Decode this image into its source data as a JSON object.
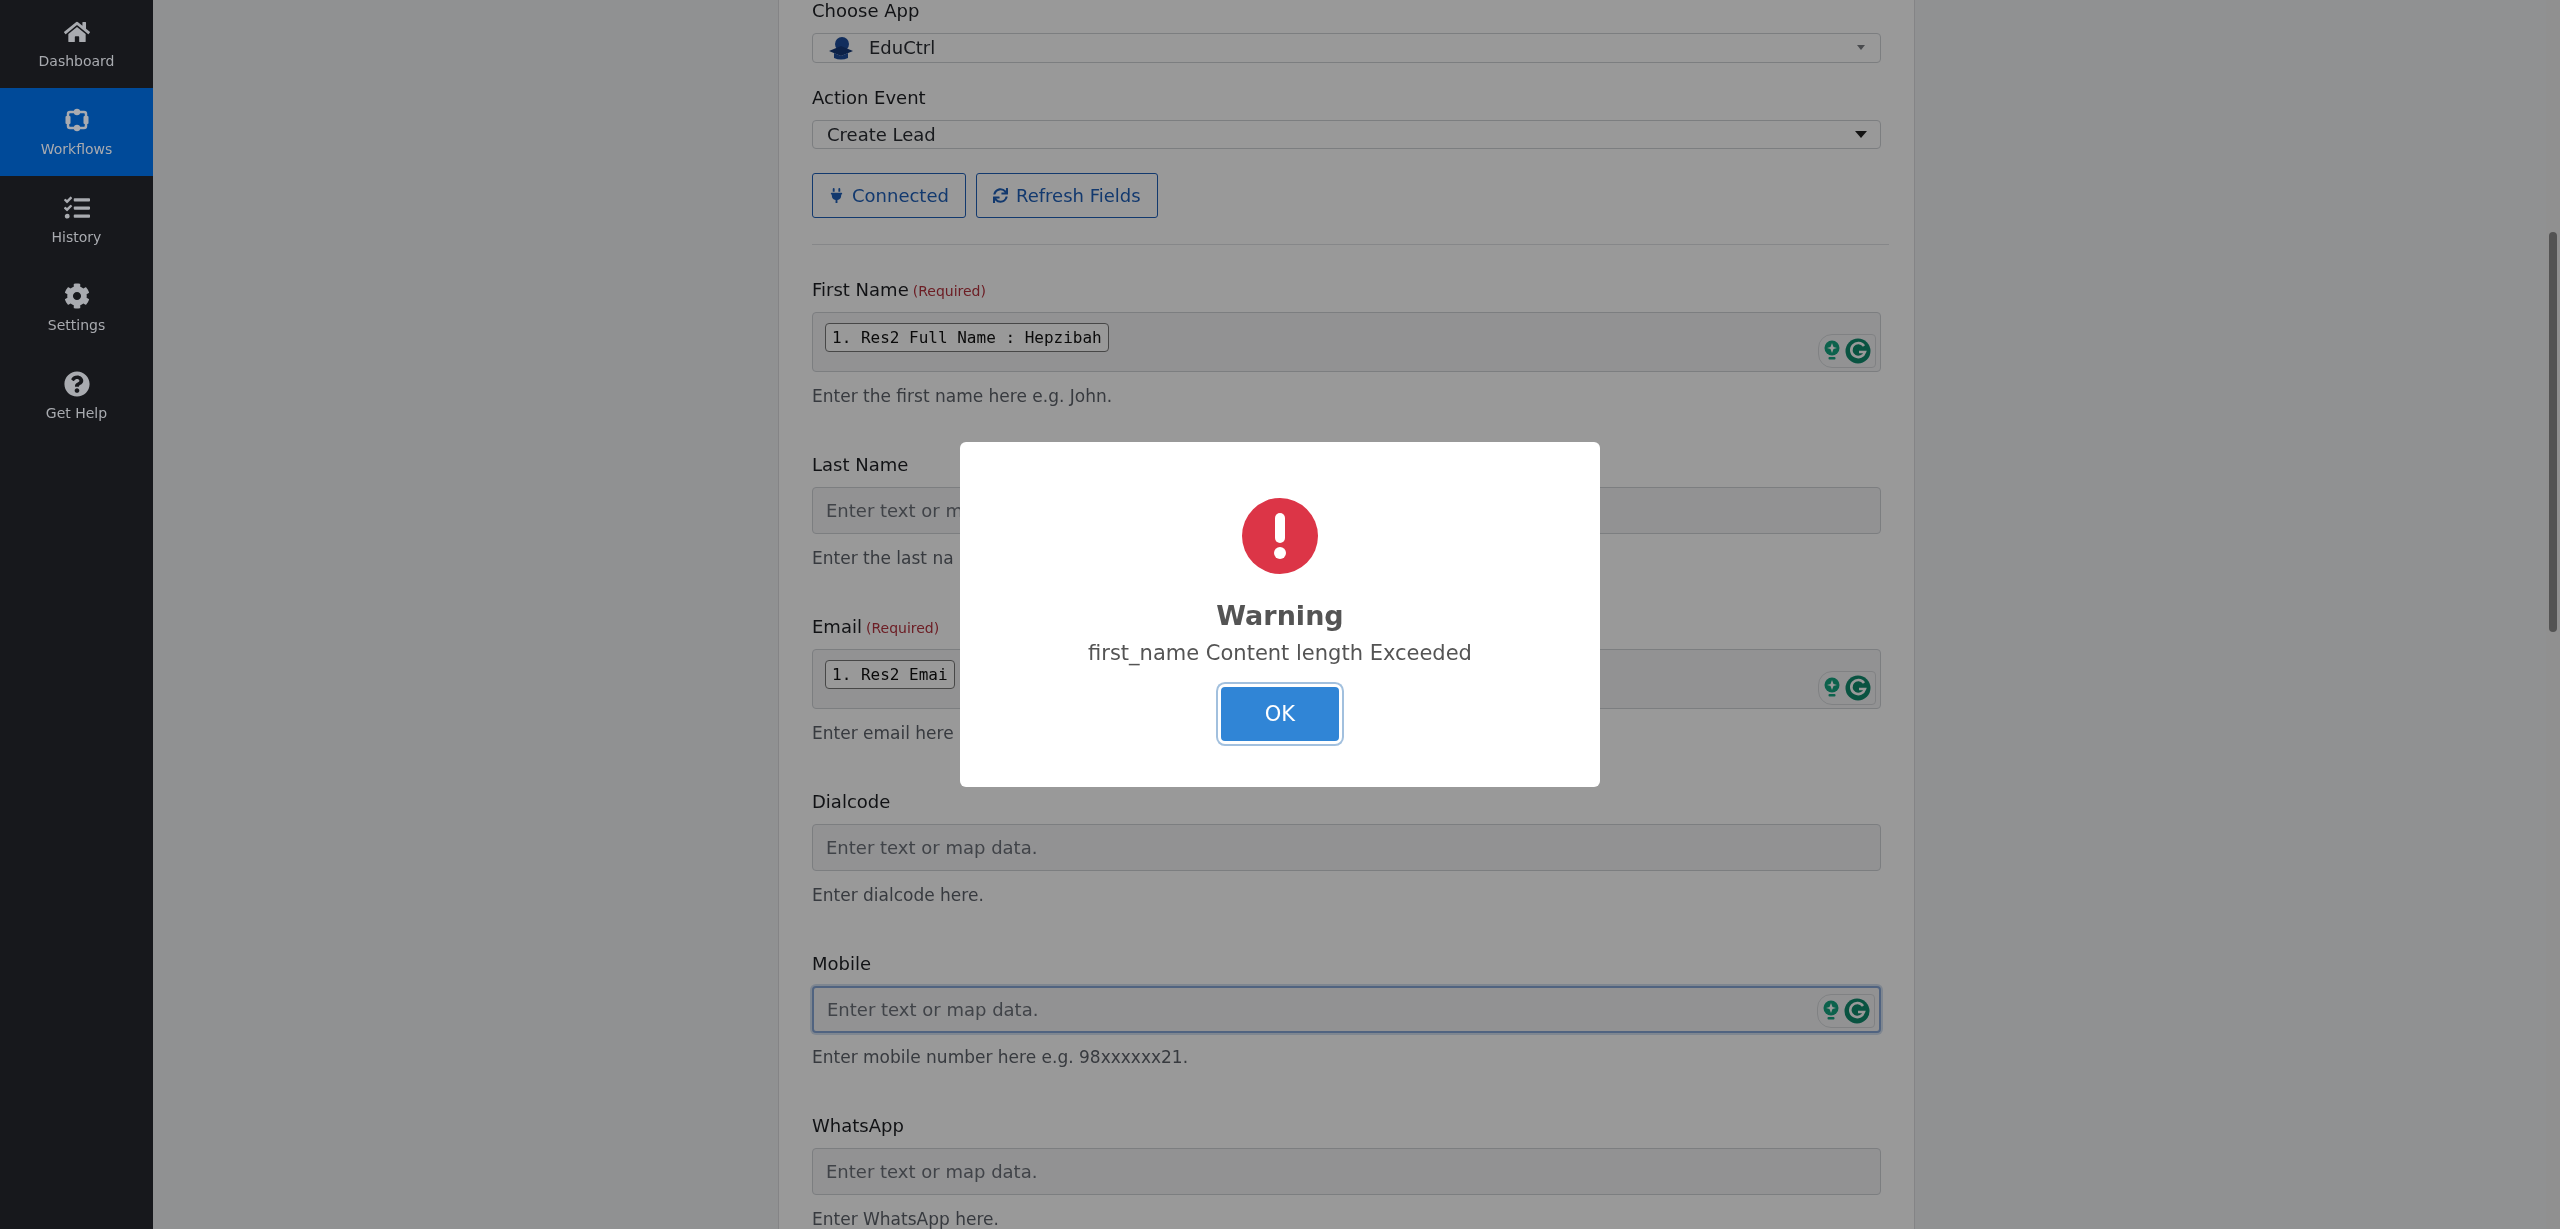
{
  "sidebar": {
    "items": [
      {
        "label": "Dashboard",
        "selected": false
      },
      {
        "label": "Workflows",
        "selected": true
      },
      {
        "label": "History",
        "selected": false
      },
      {
        "label": "Settings",
        "selected": false
      },
      {
        "label": "Get Help",
        "selected": false
      }
    ]
  },
  "form": {
    "app_select": {
      "label": "Choose App",
      "value": "EduCtrl"
    },
    "event_select": {
      "label": "Action Event",
      "value": "Create Lead"
    },
    "buttons": [
      {
        "label": "Connected"
      },
      {
        "label": "Refresh Fields"
      }
    ],
    "fields": [
      {
        "label": "First Name",
        "required_note": "(Required)",
        "chip": "1. Res2 Full Name : Hepzibah",
        "assist_icons": true,
        "focused": false,
        "hint": "Enter the first name here e.g. John."
      },
      {
        "label": "Last Name",
        "placeholder": "Enter text or m",
        "assist_icons": false,
        "focused": false,
        "hint": "Enter the last na"
      },
      {
        "label": "Email",
        "required_note": "(Required)",
        "chip": "1. Res2 Emai",
        "assist_icons": true,
        "focused": false,
        "hint": "Enter email here"
      },
      {
        "label": "Dialcode",
        "placeholder": "Enter text or map data.",
        "assist_icons": false,
        "focused": false,
        "hint": "Enter dialcode here."
      },
      {
        "label": "Mobile",
        "placeholder": "Enter text or map data.",
        "assist_icons": true,
        "focused": true,
        "hint": "Enter mobile number here e.g. 98xxxxxx21."
      },
      {
        "label": "WhatsApp",
        "placeholder": "Enter text or map data.",
        "assist_icons": false,
        "focused": false,
        "hint": "Enter WhatsApp here."
      }
    ]
  },
  "dialog": {
    "title": "Warning",
    "message": "first_name Content length Exceeded",
    "button": "OK"
  }
}
